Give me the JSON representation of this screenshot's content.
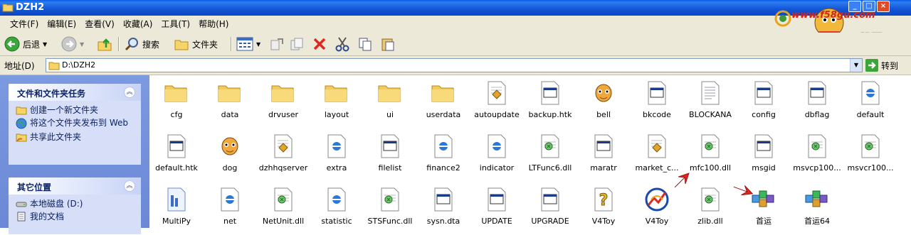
{
  "window": {
    "title": "DZH2"
  },
  "menu": [
    "文件(F)",
    "编辑(E)",
    "查看(V)",
    "收藏(A)",
    "工具(T)",
    "帮助(H)"
  ],
  "brand": {
    "url_text": "www.f58gu.com",
    "name": "股票"
  },
  "toolbar": {
    "back": "后退",
    "search": "搜索",
    "folders": "文件夹"
  },
  "address": {
    "label": "地址(D)",
    "value": "D:\\DZH2",
    "go": "转到"
  },
  "tasks_panel": {
    "title": "文件和文件夹任务",
    "items": [
      "创建一个新文件夹",
      "将这个文件夹发布到 Web",
      "共享此文件夹"
    ]
  },
  "other_panel": {
    "title": "其它位置",
    "items": [
      "本地磁盘 (D:)",
      "我的文档"
    ]
  },
  "files": [
    {
      "name": "cfg",
      "icon": "folder-icon"
    },
    {
      "name": "data",
      "icon": "folder-icon"
    },
    {
      "name": "drvuser",
      "icon": "folder-icon"
    },
    {
      "name": "layout",
      "icon": "folder-icon"
    },
    {
      "name": "ui",
      "icon": "folder-icon"
    },
    {
      "name": "userdata",
      "icon": "folder-icon"
    },
    {
      "name": "autoupdate",
      "icon": "setup-icon"
    },
    {
      "name": "backup.htk",
      "icon": "window-file-icon"
    },
    {
      "name": "bell",
      "icon": "bell-face-icon"
    },
    {
      "name": "bkcode",
      "icon": "window-file-icon"
    },
    {
      "name": "BLOCKANA",
      "icon": "text-file-icon"
    },
    {
      "name": "config",
      "icon": "window-file-icon"
    },
    {
      "name": "dbflag",
      "icon": "window-file-icon"
    },
    {
      "name": "default",
      "icon": "ie-file-icon"
    },
    {
      "name": "default.htk",
      "icon": "window-file-icon"
    },
    {
      "name": "dog",
      "icon": "bell-face-icon"
    },
    {
      "name": "dzhhqserver",
      "icon": "setup-icon"
    },
    {
      "name": "extra",
      "icon": "ie-file-icon"
    },
    {
      "name": "filelist",
      "icon": "window-file-icon"
    },
    {
      "name": "finance2",
      "icon": "ie-file-icon"
    },
    {
      "name": "indicator",
      "icon": "ie-file-icon"
    },
    {
      "name": "LTFunc6.dll",
      "icon": "dll-icon"
    },
    {
      "name": "maratr",
      "icon": "window-file-icon"
    },
    {
      "name": "market_c...",
      "icon": "setup-icon"
    },
    {
      "name": "mfc100.dll",
      "icon": "dll-icon"
    },
    {
      "name": "msgid",
      "icon": "window-file-icon"
    },
    {
      "name": "msvcp100...",
      "icon": "dll-icon"
    },
    {
      "name": "msvcr100...",
      "icon": "dll-icon"
    },
    {
      "name": "MultiPy",
      "icon": "doc-file-icon"
    },
    {
      "name": "net",
      "icon": "ie-file-icon"
    },
    {
      "name": "NetUnit.dll",
      "icon": "dll-icon"
    },
    {
      "name": "statistic",
      "icon": "ie-file-icon"
    },
    {
      "name": "STSFunc.dll",
      "icon": "dll-icon"
    },
    {
      "name": "sysn.dta",
      "icon": "window-file-icon"
    },
    {
      "name": "UPDATE",
      "icon": "window-file-icon"
    },
    {
      "name": "UPGRADE",
      "icon": "window-file-icon"
    },
    {
      "name": "V4Toy",
      "icon": "help-icon"
    },
    {
      "name": "V4Toy",
      "icon": "chart-app-icon"
    },
    {
      "name": "zlib.dll",
      "icon": "dll-icon"
    },
    {
      "name": "首运",
      "icon": "blocks-app-icon"
    },
    {
      "name": "首运64",
      "icon": "blocks-app-icon"
    }
  ]
}
